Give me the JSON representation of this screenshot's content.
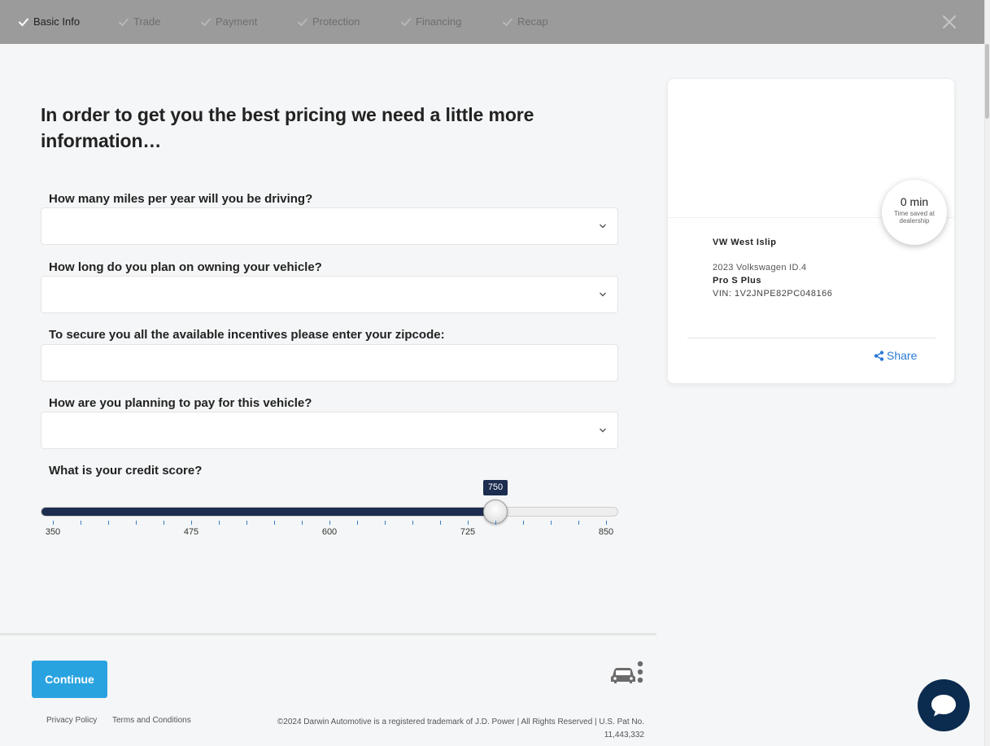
{
  "steps": [
    {
      "label": "Basic Info",
      "active": true
    },
    {
      "label": "Trade",
      "active": false
    },
    {
      "label": "Payment",
      "active": false
    },
    {
      "label": "Protection",
      "active": false
    },
    {
      "label": "Financing",
      "active": false
    },
    {
      "label": "Recap",
      "active": false
    }
  ],
  "heading": "In order to get you the best pricing we need a little more information…",
  "questions": {
    "miles": {
      "label": "How many miles per year will you be driving?",
      "value": ""
    },
    "ownership": {
      "label": "How long do you plan on owning your vehicle?",
      "value": ""
    },
    "zipcode": {
      "label": "To secure you all the available incentives please enter your zipcode:",
      "value": ""
    },
    "payment": {
      "label": "How are you planning to pay for this vehicle?",
      "value": ""
    },
    "credit": {
      "label": "What is your credit score?",
      "value": 750,
      "min": 350,
      "max": 850,
      "tick_labels": [
        "350",
        "475",
        "600",
        "725",
        "850"
      ]
    }
  },
  "footer": {
    "continue_label": "Continue",
    "privacy": "Privacy Policy",
    "terms": "Terms and Conditions",
    "copyright": "©2024 Darwin Automotive is a registered trademark of J.D. Power | All Rights Reserved | U.S. Pat No. 11,443,332"
  },
  "card": {
    "time_saved_value": "0 min",
    "time_saved_label": "Time saved at dealership",
    "dealer": "VW West Islip",
    "vehicle_year_model": "2023 Volkswagen ID.4",
    "trim": "Pro S Plus",
    "vin": "VIN: 1V2JNPE82PC048166",
    "share_label": "Share"
  },
  "colors": {
    "accent": "#29a3e0",
    "navy": "#1c2d4f",
    "link": "#2a7ad6",
    "chat": "#0b2b4f"
  },
  "icons": [
    "check-icon",
    "close-icon",
    "chevron-down-icon",
    "share-icon",
    "car-logo-icon",
    "chat-icon"
  ]
}
